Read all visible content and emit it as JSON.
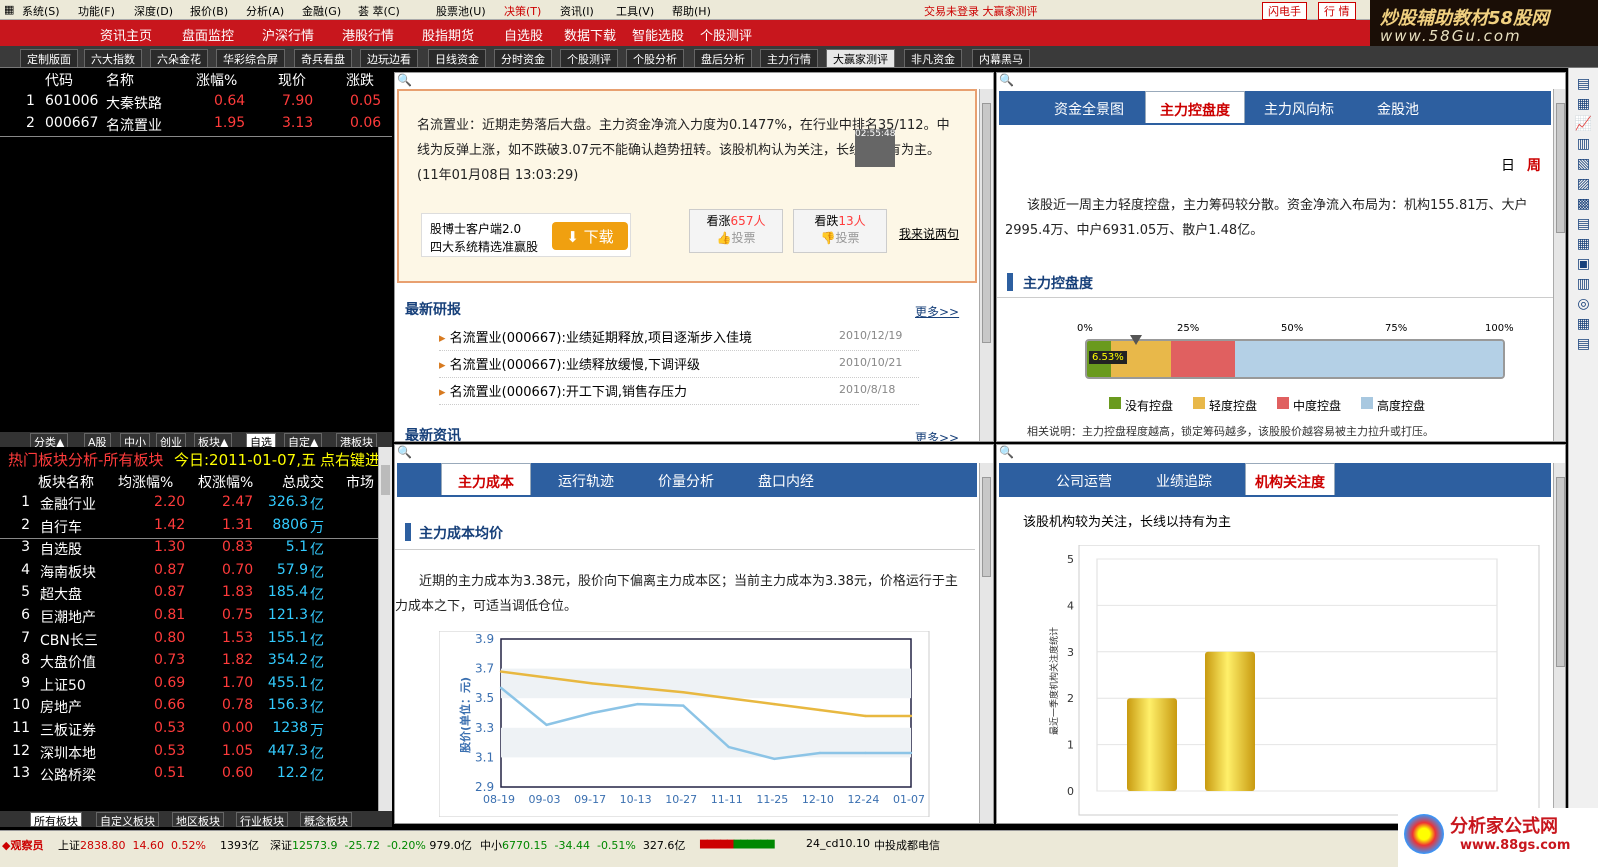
{
  "menu": [
    "系统(S)",
    "功能(F)",
    "深度(D)",
    "报价(B)",
    "分析(A)",
    "金融(G)",
    "荟 萃(C)",
    "股票池(U)",
    "决策(T)",
    "资讯(I)",
    "工具(V)",
    "帮助(H)"
  ],
  "trade_status": "交易未登录 大赢家测评",
  "top_buttons": [
    "闪电手",
    "行 情"
  ],
  "logo1": {
    "line1": "炒股辅助教材58股网",
    "line2": "www.58Gu.com"
  },
  "nav": [
    "资讯主页",
    "盘面监控",
    "沪深行情",
    "港股行情",
    "股指期货",
    "自选股",
    "数据下载",
    "智能选股",
    "个股测评"
  ],
  "tabs": [
    "定制版面",
    "六大指数",
    "六朵金花",
    "华彩综合屏",
    "奇兵看盘",
    "边玩边看",
    "日线资金",
    "分时资金",
    "个股测评",
    "个股分析",
    "盘后分析",
    "主力行情",
    "大赢家测评",
    "非凡资金",
    "内幕黑马"
  ],
  "active_tab": "大赢家测评",
  "watch": {
    "headers": [
      "代码",
      "名称",
      "涨幅%",
      "现价",
      "涨跌"
    ],
    "rows": [
      {
        "n": "1",
        "code": "601006",
        "name": "大秦铁路",
        "pct": "0.64",
        "price": "7.90",
        "chg": "0.05"
      },
      {
        "n": "2",
        "code": "000667",
        "name": "名流置业",
        "pct": "1.95",
        "price": "3.13",
        "chg": "0.06"
      }
    ]
  },
  "watch_tabs": [
    "分类▲",
    "A股",
    "中小",
    "创业",
    "板块▲",
    "自选",
    "自定▲",
    "港板块"
  ],
  "sector": {
    "title": "热门板块分析-所有板块",
    "date": "今日:2011-01-07,五",
    "hint": "点右键进",
    "headers": [
      "板块名称",
      "均涨幅%",
      "权涨幅%",
      "总成交",
      "市场"
    ],
    "rows": [
      {
        "n": "1",
        "name": "金融行业",
        "a": "2.20",
        "b": "2.47",
        "v": "326.3",
        "u": "亿"
      },
      {
        "n": "2",
        "name": "自行车",
        "a": "1.42",
        "b": "1.31",
        "v": "8806",
        "u": "万"
      },
      {
        "n": "3",
        "name": "自选股",
        "a": "1.30",
        "b": "0.83",
        "v": "5.1",
        "u": "亿"
      },
      {
        "n": "4",
        "name": "海南板块",
        "a": "0.87",
        "b": "0.70",
        "v": "57.9",
        "u": "亿"
      },
      {
        "n": "5",
        "name": "超大盘",
        "a": "0.87",
        "b": "1.83",
        "v": "185.4",
        "u": "亿"
      },
      {
        "n": "6",
        "name": "巨潮地产",
        "a": "0.81",
        "b": "0.75",
        "v": "121.3",
        "u": "亿"
      },
      {
        "n": "7",
        "name": "CBN长三",
        "a": "0.80",
        "b": "1.53",
        "v": "155.1",
        "u": "亿"
      },
      {
        "n": "8",
        "name": "大盘价值",
        "a": "0.73",
        "b": "1.82",
        "v": "354.2",
        "u": "亿"
      },
      {
        "n": "9",
        "name": "上证50",
        "a": "0.69",
        "b": "1.70",
        "v": "455.1",
        "u": "亿"
      },
      {
        "n": "10",
        "name": "房地产",
        "a": "0.66",
        "b": "0.78",
        "v": "156.3",
        "u": "亿"
      },
      {
        "n": "11",
        "name": "三板证券",
        "a": "0.53",
        "b": "0.00",
        "v": "1238",
        "u": "万"
      },
      {
        "n": "12",
        "name": "深圳本地",
        "a": "0.53",
        "b": "1.05",
        "v": "447.3",
        "u": "亿"
      },
      {
        "n": "13",
        "name": "公路桥梁",
        "a": "0.51",
        "b": "0.60",
        "v": "12.2",
        "u": "亿"
      }
    ]
  },
  "sector_tabs": [
    "所有板块",
    "自定义板块",
    "地区板块",
    "行业板块",
    "概念板块"
  ],
  "summary": {
    "text": "名流置业：近期走势落后大盘。主力资金净流入力度为0.1477%，在行业中排名35/112。中线为反弹上涨，如不跌破3.07元不能确认趋势扭转。该股机构认为关注，长线以持有为主。(11年01月08日 13:03:29)",
    "timer": "02:55:48",
    "ad1": "股博士客户端2.0",
    "ad2": "四大系统精选准赢股",
    "download": "下载",
    "up_label": "看涨",
    "up_n": "657人",
    "vote": "投票",
    "down_label": "看跌",
    "down_n": "13人",
    "say": "我来说两句"
  },
  "research": {
    "title": "最新研报",
    "more": "更多>>",
    "items": [
      {
        "t": "名流置业(000667):业绩延期释放,项目逐渐步入佳境",
        "d": "2010/12/19"
      },
      {
        "t": "名流置业(000667):业绩释放缓慢,下调评级",
        "d": "2010/10/21"
      },
      {
        "t": "名流置业(000667):开工下调,销售存压力",
        "d": "2010/8/18"
      }
    ],
    "next": "最新资讯",
    "next_more": "更多>>"
  },
  "capital": {
    "tabs": [
      "资金全景图",
      "主力控盘度",
      "主力风向标",
      "金股池"
    ],
    "active": "主力控盘度",
    "period": [
      "日",
      "周"
    ],
    "desc": "该股近一周主力轻度控盘，主力筹码较分散。资金净流入布局为：机构155.81万、大户2995.4万、中户6931.05万、散户1.48亿。",
    "section": "主力控盘度",
    "ticks": [
      "0%",
      "25%",
      "50%",
      "75%",
      "100%"
    ],
    "value": "6.53%",
    "value_pct": 6.53,
    "legend": [
      "没有控盘",
      "轻度控盘",
      "中度控盘",
      "高度控盘"
    ],
    "legend_colors": [
      "#6a9a1e",
      "#e8b84a",
      "#e06060",
      "#a8c8e0"
    ],
    "note": "相关说明：主力控盘程度越高，锁定筹码越多，该股股价越容易被主力拉升或打压。"
  },
  "cost": {
    "tabs": [
      "主力成本",
      "运行轨迹",
      "价量分析",
      "盘口内经"
    ],
    "active": "主力成本",
    "section": "主力成本均价",
    "desc": "近期的主力成本为3.38元，股价向下偏离主力成本区；当前主力成本为3.38元，价格运行于主力成本之下，可适当调低仓位。"
  },
  "chart_data": [
    {
      "type": "line",
      "ylabel": "股价(单位：元)",
      "ylim": [
        2.9,
        3.9
      ],
      "y_ticks": [
        "3.9",
        "3.7",
        "3.5",
        "3.3",
        "3.1",
        "2.9"
      ],
      "categories": [
        "08-19",
        "09-03",
        "09-17",
        "10-13",
        "10-27",
        "11-11",
        "11-25",
        "12-10",
        "12-24",
        "01-07"
      ],
      "series": [
        {
          "name": "",
          "color": "#e8b840",
          "values": [
            3.68,
            3.64,
            3.6,
            3.57,
            3.54,
            3.5,
            3.46,
            3.42,
            3.38,
            3.38
          ]
        },
        {
          "name": "",
          "color": "#8cc4e6",
          "values": [
            3.57,
            3.32,
            3.4,
            3.46,
            3.45,
            3.17,
            3.09,
            3.13,
            3.13,
            3.13
          ]
        }
      ]
    },
    {
      "type": "bar",
      "ylabel": "最近一季度机构关注度统计",
      "ylim": [
        0,
        5
      ],
      "y_ticks": [
        "5",
        "4",
        "3",
        "2",
        "1",
        "0"
      ],
      "values": [
        2,
        3,
        0,
        0,
        0,
        0,
        0
      ]
    }
  ],
  "institution": {
    "tabs": [
      "公司运营",
      "业绩追踪",
      "机构关注度"
    ],
    "active": "机构关注度",
    "desc": "该股机构较为关注，长线以持有为主"
  },
  "status": {
    "label": "观察员",
    "sh": "上证",
    "sh_v": "2838.80",
    "sh_c": "14.60",
    "sh_p": "0.52%",
    "sh_a": "1393亿",
    "sz": "深证",
    "sz_v": "12573.9",
    "sz_c": "-25.72",
    "sz_p": "-0.20%",
    "sz_a": "979.0亿",
    "zx": "中小",
    "zx_v": "6770.15",
    "zx_c": "-34.44",
    "zx_p": "-0.51%",
    "zx_a": "327.6亿",
    "ver": "24_cd10.10",
    "isp": "中投成都电信"
  },
  "logo2": {
    "line1": "分析家公式网",
    "line2": "www.88gs.com"
  }
}
